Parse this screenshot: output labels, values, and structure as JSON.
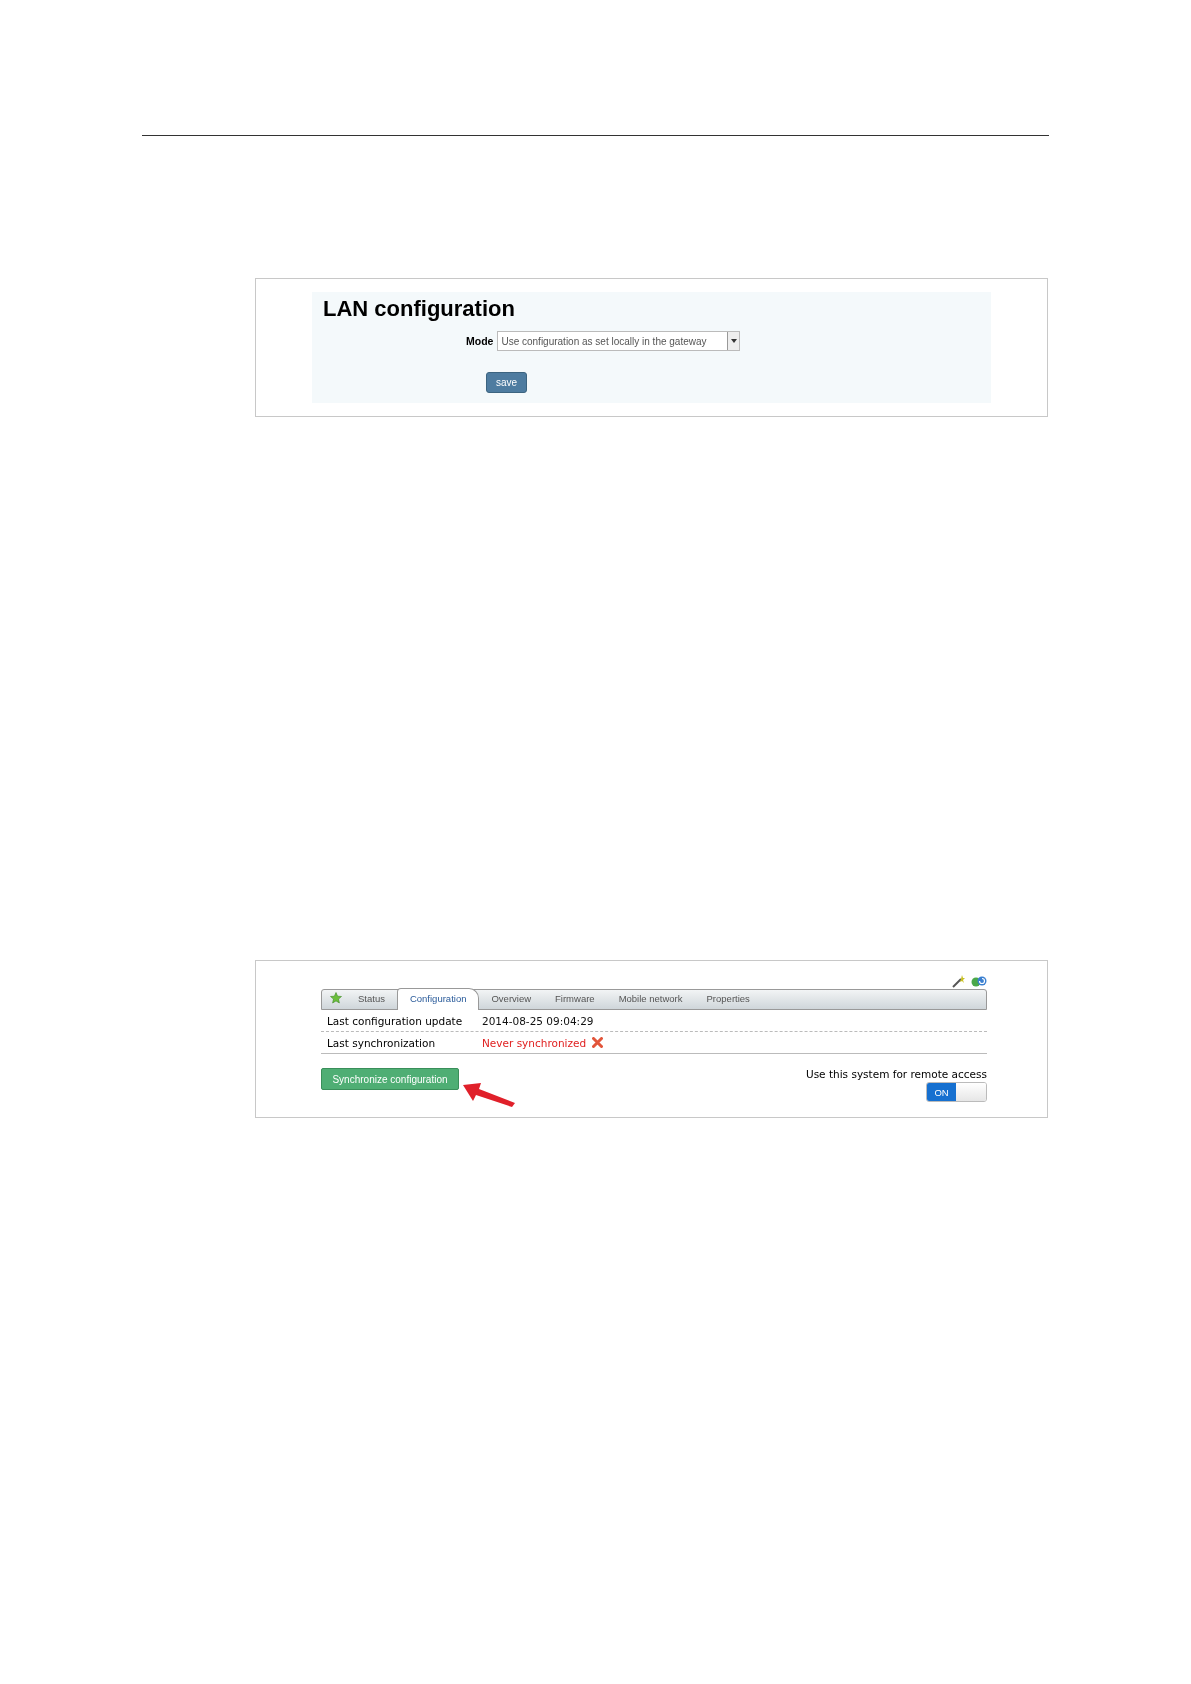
{
  "lan_panel": {
    "title": "LAN configuration",
    "mode_label": "Mode",
    "mode_value": "Use configuration as set locally in the gateway",
    "save_button": "save"
  },
  "system_panel": {
    "tabs": [
      {
        "kind": "icon",
        "selected": false
      },
      {
        "kind": "text",
        "label": "Status",
        "selected": false
      },
      {
        "kind": "text",
        "label": "Configuration",
        "selected": true
      },
      {
        "kind": "text",
        "label": "Overview",
        "selected": false
      },
      {
        "kind": "text",
        "label": "Firmware",
        "selected": false
      },
      {
        "kind": "text",
        "label": "Mobile network",
        "selected": false
      },
      {
        "kind": "text",
        "label": "Properties",
        "selected": false
      }
    ],
    "rows": [
      {
        "label": "Last configuration update",
        "value": "2014-08-25 09:04:29",
        "error": false
      },
      {
        "label": "Last synchronization",
        "value": "Never synchronized",
        "error": true
      }
    ],
    "sync_button": "Synchronize configuration",
    "remote_access_label": "Use this system for remote access",
    "remote_access": {
      "on": true,
      "label": "ON"
    }
  }
}
